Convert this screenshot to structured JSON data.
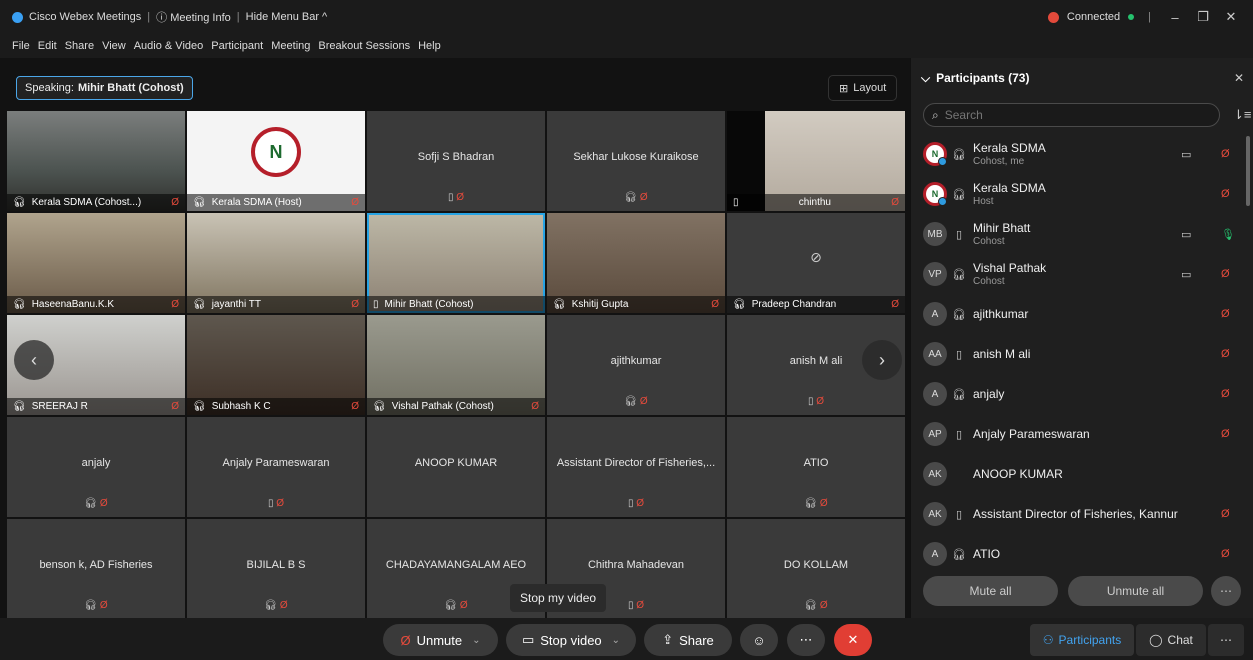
{
  "titlebar": {
    "app": "Cisco Webex Meetings",
    "meeting_info": "Meeting Info",
    "hide_menu": "Hide Menu Bar ^",
    "status": "Connected",
    "colors": {
      "connected_dot": "#25c26e",
      "status_icon": "#e34a3b"
    }
  },
  "menu": [
    "File",
    "Edit",
    "Share",
    "View",
    "Audio & Video",
    "Participant",
    "Meeting",
    "Breakout Sessions",
    "Help"
  ],
  "stage": {
    "speaking_label": "Speaking:",
    "speaking_name": "Mihir Bhatt (Cohost)",
    "layout_label": "Layout"
  },
  "tiles": [
    {
      "name": "Kerala SDMA  (Cohost...)",
      "video": true
    },
    {
      "name": "Kerala SDMA  (Host)",
      "video": true
    },
    {
      "name": "Sofji S Bhadran",
      "video": false
    },
    {
      "name": "Sekhar Lukose Kuraikose",
      "video": false
    },
    {
      "name": "chinthu",
      "video": true
    },
    {
      "name": "HaseenaBanu.K.K",
      "video": true
    },
    {
      "name": "jayanthi TT",
      "video": true
    },
    {
      "name": "Mihir Bhatt  (Cohost)",
      "video": true,
      "active": true
    },
    {
      "name": "Kshitij Gupta",
      "video": true
    },
    {
      "name": "Pradeep Chandran",
      "video": true
    },
    {
      "name": "SREERAJ R",
      "video": true
    },
    {
      "name": "Subhash K C",
      "video": true
    },
    {
      "name": "Vishal Pathak  (Cohost)",
      "video": true
    },
    {
      "name": "ajithkumar",
      "video": false
    },
    {
      "name": "anish M ali",
      "video": false
    },
    {
      "name": "anjaly",
      "video": false
    },
    {
      "name": "Anjaly Parameswaran",
      "video": false
    },
    {
      "name": "ANOOP KUMAR",
      "video": false
    },
    {
      "name": "Assistant Director of Fisheries,...",
      "video": false
    },
    {
      "name": "ATIO",
      "video": false
    },
    {
      "name": "benson k, AD Fisheries",
      "video": false
    },
    {
      "name": "BIJILAL B S",
      "video": false
    },
    {
      "name": "CHADAYAMANGALAM AEO",
      "video": false
    },
    {
      "name": "Chithra Mahadevan",
      "video": false
    },
    {
      "name": "DO KOLLAM",
      "video": false
    }
  ],
  "tooltip": "Stop my video",
  "controls": {
    "unmute": "Unmute",
    "stop_video": "Stop video",
    "share": "Share",
    "participants": "Participants",
    "chat": "Chat"
  },
  "panel": {
    "title": "Participants (73)",
    "search_placeholder": "Search",
    "participants": [
      {
        "initials": "",
        "logo": true,
        "badge": true,
        "name": "Kerala SDMA",
        "role": "Cohost, me",
        "device": "headset",
        "camera": true,
        "mic": "muted"
      },
      {
        "initials": "",
        "logo": true,
        "badge": true,
        "name": "Kerala SDMA",
        "role": "Host",
        "device": "headset",
        "camera": false,
        "mic": "muted"
      },
      {
        "initials": "MB",
        "name": "Mihir Bhatt",
        "role": "Cohost",
        "device": "phone",
        "camera": true,
        "mic": "on"
      },
      {
        "initials": "VP",
        "name": "Vishal Pathak",
        "role": "Cohost",
        "device": "headset",
        "camera": true,
        "mic": "muted"
      },
      {
        "initials": "A",
        "name": "ajithkumar",
        "role": "",
        "device": "headset",
        "camera": false,
        "mic": "muted"
      },
      {
        "initials": "AA",
        "name": "anish M ali",
        "role": "",
        "device": "phone",
        "camera": false,
        "mic": "muted"
      },
      {
        "initials": "A",
        "name": "anjaly",
        "role": "",
        "device": "headset",
        "camera": false,
        "mic": "muted"
      },
      {
        "initials": "AP",
        "name": "Anjaly Parameswaran",
        "role": "",
        "device": "phone",
        "camera": false,
        "mic": "muted"
      },
      {
        "initials": "AK",
        "name": "ANOOP KUMAR",
        "role": "",
        "device": "",
        "camera": false,
        "mic": ""
      },
      {
        "initials": "AK",
        "name": "Assistant Director of Fisheries, Kannur",
        "role": "",
        "device": "phone",
        "camera": false,
        "mic": "muted"
      },
      {
        "initials": "A",
        "name": "ATIO",
        "role": "",
        "device": "headset",
        "camera": false,
        "mic": "muted"
      }
    ],
    "mute_all": "Mute all",
    "unmute_all": "Unmute all"
  }
}
